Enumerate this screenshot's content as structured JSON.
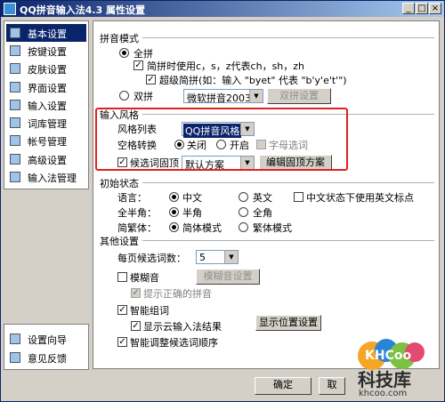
{
  "window": {
    "title": "QQ拼音输入法4.3 属性设置"
  },
  "nav": {
    "items": [
      {
        "label": "基本设置"
      },
      {
        "label": "按键设置"
      },
      {
        "label": "皮肤设置"
      },
      {
        "label": "界面设置"
      },
      {
        "label": "输入设置"
      },
      {
        "label": "词库管理"
      },
      {
        "label": "帐号管理"
      },
      {
        "label": "高级设置"
      },
      {
        "label": "输入法管理"
      }
    ],
    "bottom": [
      {
        "label": "设置向导"
      },
      {
        "label": "意见反馈"
      }
    ]
  },
  "pinyin_mode": {
    "title": "拼音模式",
    "full": "全拼",
    "simple_full": "简拼时使用c，s，z代表ch，sh，zh",
    "super_simple": "超级简拼(如：输入 \"byet\" 代表 \"b'y'e't'\")",
    "shuangpin": "双拼",
    "shuangpin_select": "微软拼音2003",
    "shuangpin_button": "双拼设置"
  },
  "input_style": {
    "title": "输入风格",
    "style_list_label": "风格列表",
    "style_select": "QQ拼音风格",
    "space_convert_label": "空格转换",
    "off": "关闭",
    "on": "开启",
    "letter_select": "字母选词",
    "candidate_fixed": "候选词固顶",
    "candidate_select": "默认方案",
    "edit_button": "编辑固顶方案"
  },
  "initial_state": {
    "title": "初始状态",
    "language_label": "语言：",
    "chinese": "中文",
    "english": "英文",
    "english_punct": "中文状态下使用英文标点",
    "width_label": "全半角：",
    "half": "半角",
    "full": "全角",
    "trad_label": "简繁体：",
    "simplified": "简体模式",
    "traditional": "繁体模式"
  },
  "other": {
    "title": "其他设置",
    "candidates_label": "每页候选词数：",
    "candidates_value": "5",
    "fuzzy": "模糊音",
    "fuzzy_button": "模糊音设置",
    "hint_correct": "提示正确的拼音",
    "smart_group": "智能组词",
    "cloud_result": "显示云输入法结果",
    "position_button": "显示位置设置",
    "smart_adjust": "智能调整候选词顺序"
  },
  "footer": {
    "ok": "确定",
    "cancel": "取"
  },
  "brand": {
    "logo": "KHCoo",
    "name": "科技库",
    "url": "khcoo.com"
  }
}
